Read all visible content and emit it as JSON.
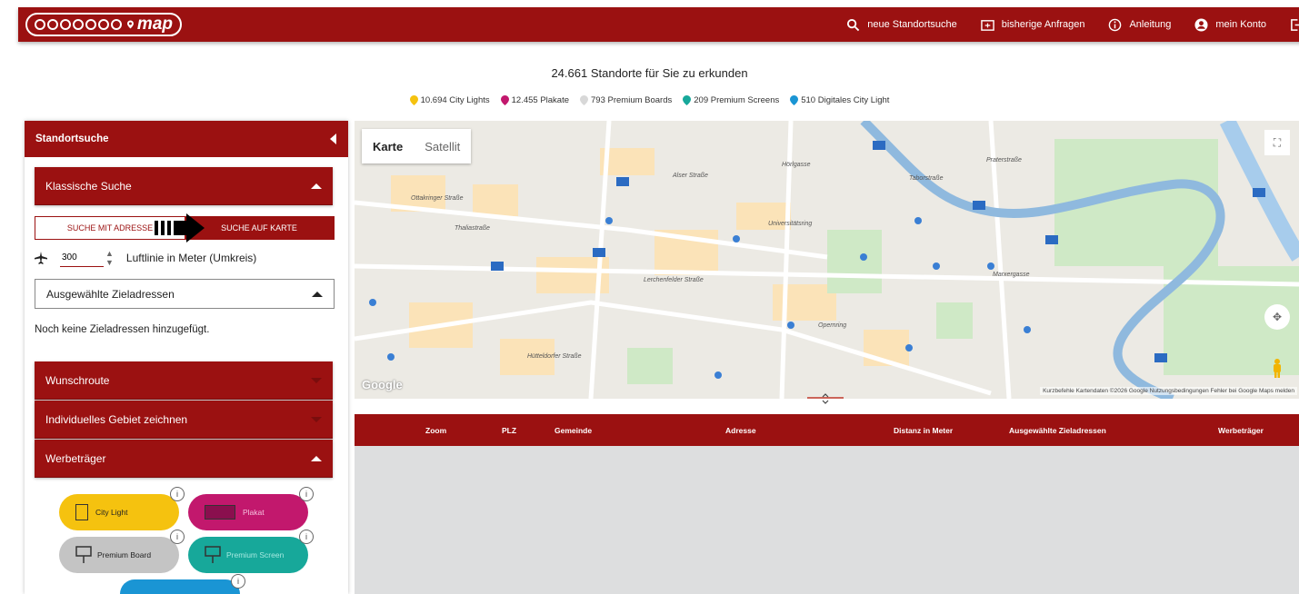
{
  "header": {
    "logo_text": "map",
    "nav": [
      {
        "label": "neue Standortsuche",
        "icon": "search-icon"
      },
      {
        "label": "bisherige Anfragen",
        "icon": "folder-icon"
      },
      {
        "label": "Anleitung",
        "icon": "info-icon"
      },
      {
        "label": "mein Konto",
        "icon": "account-icon"
      }
    ],
    "logout_icon": "logout-icon"
  },
  "summary": {
    "title": "24.661 Standorte für Sie zu erkunden",
    "legend": [
      {
        "label": "10.694 City Lights",
        "color": "#f5c20f"
      },
      {
        "label": "12.455 Plakate",
        "color": "#c2186d"
      },
      {
        "label": "793 Premium Boards",
        "color": "#d8d8d8"
      },
      {
        "label": "209 Premium Screens",
        "color": "#17a89a"
      },
      {
        "label": "510 Digitales City Light",
        "color": "#1a95d4"
      }
    ]
  },
  "sidebar": {
    "title": "Standortsuche",
    "classic_search": "Klassische Suche",
    "toggle_address": "SUCHE MIT ADRESSE",
    "toggle_map": "SUCHE AUF KARTE",
    "radius_value": "300",
    "radius_label": "Luftlinie in Meter (Umkreis)",
    "selected_destinations": "Ausgewählte Zieladressen",
    "no_destinations": "Noch keine Zieladressen hinzugefügt.",
    "wunschroute": "Wunschroute",
    "draw_area": "Individuelles Gebiet zeichnen",
    "carriers": "Werbeträger",
    "carrier_types": [
      {
        "label": "City Light",
        "color": "#f5c20f"
      },
      {
        "label": "Plakat",
        "color": "#c2186d"
      },
      {
        "label": "Premium Board",
        "color": "#c4c4c4"
      },
      {
        "label": "Premium Screen",
        "color": "#17a89a"
      },
      {
        "label": "",
        "color": "#1a95d4"
      }
    ],
    "info_glyph": "i"
  },
  "map": {
    "tab_map": "Karte",
    "tab_satellite": "Satellit",
    "google_logo": "Google",
    "attribution": "Kurzbefehle   Kartendaten ©2026 Google   Nutzungsbedingungen   Fehler bei Google Maps melden",
    "streets": [
      "Alser Straße",
      "Ottakringer Straße",
      "Thaliastraße",
      "Lerchenfelder Straße",
      "Opernring",
      "Marxergasse",
      "Hütteldorfer Straße",
      "Praterstraße",
      "Universitätsring",
      "Taborstraße",
      "Hörlgasse"
    ]
  },
  "table": {
    "columns": [
      "Zoom",
      "PLZ",
      "Gemeinde",
      "Adresse",
      "Distanz in Meter",
      "Ausgewählte Zieladressen",
      "Werbeträger"
    ]
  }
}
